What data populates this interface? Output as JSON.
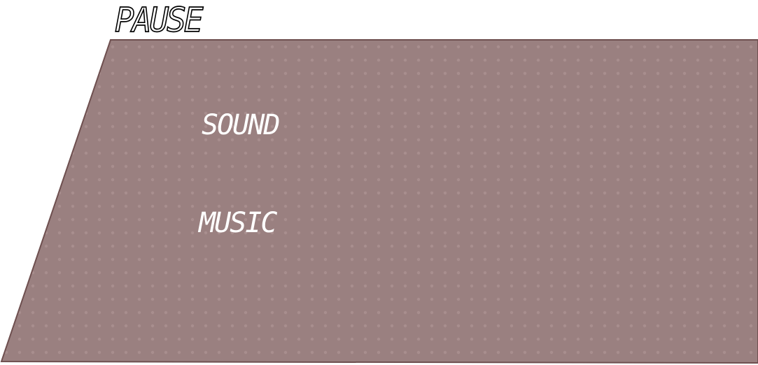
{
  "pause_menu": {
    "title": "PAUSE",
    "options": {
      "sound": "SOUND",
      "music": "MUSIC"
    }
  },
  "colors": {
    "panel_fill": "#9a8080",
    "panel_border": "#6e4f4f",
    "panel_dots": "#a88e8e",
    "text": "#ffffff",
    "title_outline": "#000000"
  }
}
